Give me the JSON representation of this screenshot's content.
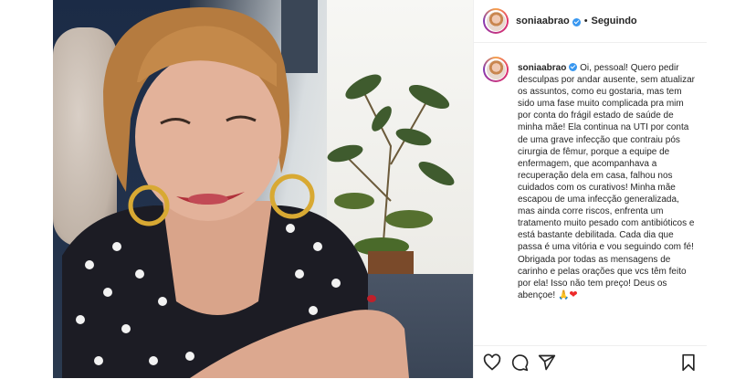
{
  "post": {
    "username": "soniaabrao",
    "separator": "•",
    "follow_status": "Seguindo",
    "caption": "Oi, pessoal! Quero pedir desculpas por andar ausente, sem atualizar os assuntos, como eu gostaria, mas tem sido uma fase muito complicada pra mim por conta do frágil estado de saúde de minha mãe! Ela continua na UTI por conta de uma grave infecção que contraiu pós cirurgia de fêmur, porque a equipe de enfermagem, que acompanhava a recuperação dela em casa, falhou nos cuidados com os curativos! Minha mãe escapou de uma infecção generalizada, mas ainda corre riscos, enfrenta um tratamento muito pesado com antibióticos e está bastante debilitada. Cada dia que passa é uma vitória e vou seguindo com fé! Obrigada por todas as mensagens de carinho e pelas orações que vcs têm feito por ela! Isso não tem preço! Deus os abençoe!",
    "caption_emojis": [
      "🙏",
      "❤"
    ],
    "verified": true
  },
  "colors": {
    "verified_badge": "#3897f0",
    "text": "#262626",
    "border": "#efefef",
    "heart": "#ed2a2a"
  },
  "icons": [
    "heart-outline-icon",
    "comment-icon",
    "share-icon",
    "bookmark-icon",
    "verified-icon"
  ]
}
